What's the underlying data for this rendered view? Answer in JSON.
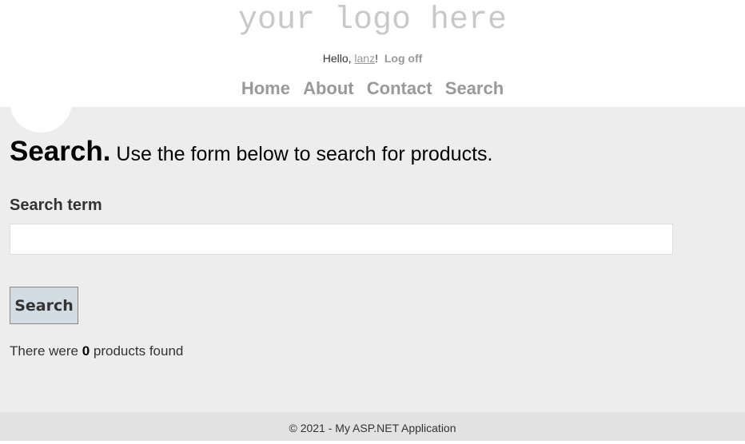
{
  "header": {
    "logo_text": "your logo here",
    "greeting_prefix": "Hello, ",
    "username": "lanz",
    "greeting_suffix": "!",
    "logoff_label": "Log off"
  },
  "nav": {
    "items": [
      {
        "label": "Home"
      },
      {
        "label": "About"
      },
      {
        "label": "Contact"
      },
      {
        "label": "Search"
      }
    ]
  },
  "main": {
    "title_strong": "Search.",
    "title_rest": " Use the form below to search for products.",
    "search_label": "Search term",
    "search_value": "",
    "search_button_label": "Search",
    "results_prefix": "There were ",
    "results_count": "0",
    "results_suffix": " products found"
  },
  "footer": {
    "text": "© 2021 - My ASP.NET Application"
  }
}
